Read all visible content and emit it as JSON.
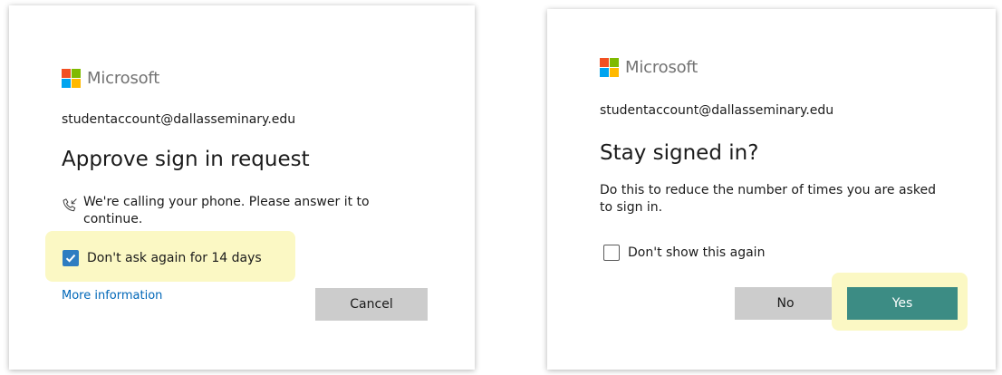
{
  "colors": {
    "highlight": "#fbf8c4",
    "checkbox_checked": "#2e7dc1",
    "link": "#0067b8",
    "primary_button": "#3c8c84",
    "secondary_button": "#cccccc",
    "logo_red": "#f25022",
    "logo_green": "#7fba00",
    "logo_blue": "#00a4ef",
    "logo_yellow": "#ffb900"
  },
  "approve_dialog": {
    "logo_text": "Microsoft",
    "account": "studentaccount@dallasseminary.edu",
    "title": "Approve sign in request",
    "phone_icon": "phone-icon",
    "message_line1": "We're calling your phone. Please answer it to",
    "message_line2": "continue.",
    "remember_checked": true,
    "remember_label": "Don't ask again for 14 days",
    "more_info_link": "More information",
    "cancel_label": "Cancel"
  },
  "stay_signed_in_dialog": {
    "logo_text": "Microsoft",
    "account": "studentaccount@dallasseminary.edu",
    "title": "Stay signed in?",
    "description_line1": "Do this to reduce the number of times you are asked",
    "description_line2": "to sign in.",
    "dont_show_checked": false,
    "dont_show_label": "Don't show this again",
    "no_label": "No",
    "yes_label": "Yes"
  }
}
